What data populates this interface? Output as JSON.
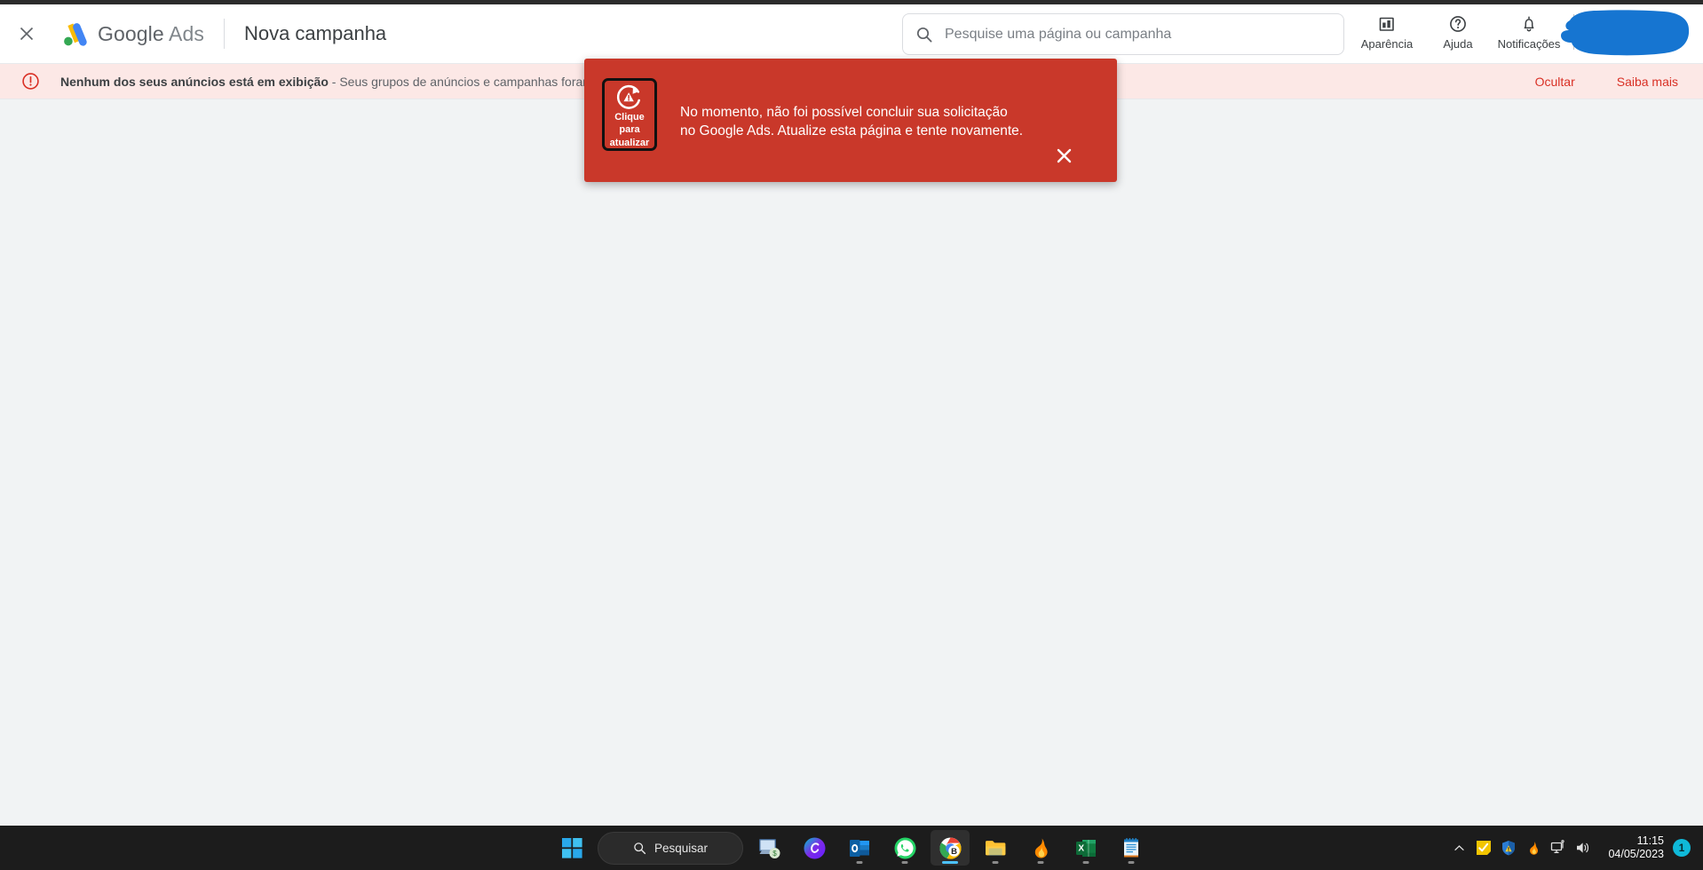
{
  "header": {
    "close_icon": "close-icon",
    "brand_google": "Google",
    "brand_ads": "Ads",
    "page_title": "Nova campanha",
    "actions": [
      {
        "label": "Aparência",
        "icon": "appearance-icon"
      },
      {
        "label": "Ajuda",
        "icon": "help-icon"
      },
      {
        "label": "Notificações",
        "icon": "bell-icon"
      }
    ],
    "redaction_color": "#1675d1"
  },
  "search": {
    "placeholder": "Pesquise uma página ou campanha",
    "value": "",
    "icon": "search-icon"
  },
  "alert": {
    "icon": "alert-circle-icon",
    "title": "Nenhum dos seus anúncios está em exibição",
    "separator": " - ",
    "detail": "Seus grupos de anúncios e campanhas foram pausados",
    "hide_label": "Ocultar",
    "learn_more_label": "Saiba mais",
    "bg_color": "#fce8e6",
    "link_color": "#d93025"
  },
  "error_dialog": {
    "refresh_button": {
      "icon": "refresh-warning-icon",
      "line1": "Clique",
      "line2": "para",
      "line3": "atualizar"
    },
    "message": "No momento, não foi possível concluir sua solicitação no Google Ads. Atualize esta página e tente novamente.",
    "close_icon": "close-icon",
    "bg_color": "#c9382a"
  },
  "taskbar": {
    "start_icon": "windows-start-icon",
    "search": {
      "label": "Pesquisar",
      "icon": "search-icon"
    },
    "apps": [
      {
        "name": "remote-desktop-icon",
        "running": false,
        "active": false
      },
      {
        "name": "canva-icon",
        "running": false,
        "active": false
      },
      {
        "name": "outlook-icon",
        "running": true,
        "active": false
      },
      {
        "name": "whatsapp-icon",
        "running": true,
        "active": false
      },
      {
        "name": "chrome-icon",
        "running": true,
        "active": true
      },
      {
        "name": "file-explorer-icon",
        "running": true,
        "active": false
      },
      {
        "name": "flame-app-icon",
        "running": true,
        "active": false
      },
      {
        "name": "excel-icon",
        "running": true,
        "active": false
      },
      {
        "name": "notepad-icon",
        "running": true,
        "active": false
      }
    ],
    "tray": {
      "overflow_icon": "chevron-up-icon",
      "icons": [
        "yellow-checkbox-icon",
        "windows-security-warning-icon",
        "flame-app-icon",
        "network-icon",
        "volume-icon"
      ],
      "time": "11:15",
      "date": "04/05/2023",
      "notification_count": "1",
      "badge_color": "#0fb9d9"
    }
  }
}
